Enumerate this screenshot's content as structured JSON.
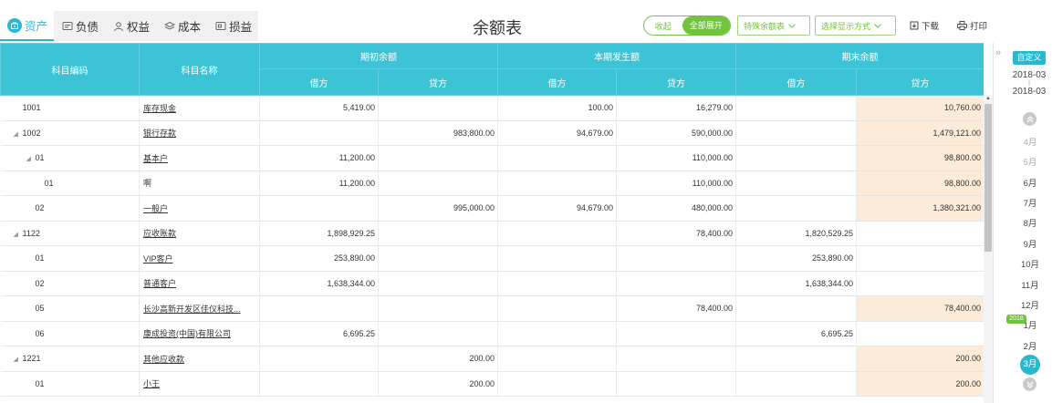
{
  "tabs": [
    {
      "label": "资产",
      "icon": "asset-icon",
      "active": true
    },
    {
      "label": "负债",
      "icon": "liability-icon",
      "active": false
    },
    {
      "label": "权益",
      "icon": "equity-icon",
      "active": false
    },
    {
      "label": "成本",
      "icon": "cost-icon",
      "active": false
    },
    {
      "label": "损益",
      "icon": "profit-loss-icon",
      "active": false
    }
  ],
  "title": "余额表",
  "toolbar": {
    "collapse_label": "收起",
    "expand_all_label": "全部展开",
    "special_balance_label": "特殊余额表",
    "display_mode_label": "选择显示方式",
    "download_label": "下载",
    "print_label": "打印"
  },
  "table": {
    "headers": {
      "code": "科目编码",
      "name": "科目名称",
      "opening": "期初余额",
      "current": "本期发生额",
      "closing": "期末余额",
      "debit": "借方",
      "credit": "贷方"
    },
    "rows": [
      {
        "code": "1001",
        "name": "库存现金",
        "op_debit": "5,419.00",
        "op_credit": "",
        "cur_debit": "100.00",
        "cur_credit": "16,279.00",
        "cl_debit": "",
        "cl_credit": "10,760.00"
      },
      {
        "code": "1002",
        "name": "银行存款",
        "op_debit": "",
        "op_credit": "983,800.00",
        "cur_debit": "94,679.00",
        "cur_credit": "590,000.00",
        "cl_debit": "",
        "cl_credit": "1,479,121.00"
      },
      {
        "code": "01",
        "name": "基本户",
        "op_debit": "11,200.00",
        "op_credit": "",
        "cur_debit": "",
        "cur_credit": "110,000.00",
        "cl_debit": "",
        "cl_credit": "98,800.00"
      },
      {
        "code": "01",
        "name": "啊",
        "op_debit": "11,200.00",
        "op_credit": "",
        "cur_debit": "",
        "cur_credit": "110,000.00",
        "cl_debit": "",
        "cl_credit": "98,800.00"
      },
      {
        "code": "02",
        "name": "一般户",
        "op_debit": "",
        "op_credit": "995,000.00",
        "cur_debit": "94,679.00",
        "cur_credit": "480,000.00",
        "cl_debit": "",
        "cl_credit": "1,380,321.00"
      },
      {
        "code": "1122",
        "name": "应收账款",
        "op_debit": "1,898,929.25",
        "op_credit": "",
        "cur_debit": "",
        "cur_credit": "78,400.00",
        "cl_debit": "1,820,529.25",
        "cl_credit": ""
      },
      {
        "code": "01",
        "name": "VIP客户",
        "op_debit": "253,890.00",
        "op_credit": "",
        "cur_debit": "",
        "cur_credit": "",
        "cl_debit": "253,890.00",
        "cl_credit": ""
      },
      {
        "code": "02",
        "name": "普通客户",
        "op_debit": "1,638,344.00",
        "op_credit": "",
        "cur_debit": "",
        "cur_credit": "",
        "cl_debit": "1,638,344.00",
        "cl_credit": ""
      },
      {
        "code": "05",
        "name": "长沙高新开发区佳仪科技...",
        "op_debit": "",
        "op_credit": "",
        "cur_debit": "",
        "cur_credit": "78,400.00",
        "cl_debit": "",
        "cl_credit": "78,400.00"
      },
      {
        "code": "06",
        "name": "康成投资(中国)有限公司",
        "op_debit": "6,695.25",
        "op_credit": "",
        "cur_debit": "",
        "cur_credit": "",
        "cl_debit": "6,695.25",
        "cl_credit": ""
      },
      {
        "code": "1221",
        "name": "其他应收款",
        "op_debit": "",
        "op_credit": "200.00",
        "cur_debit": "",
        "cur_credit": "",
        "cl_debit": "",
        "cl_credit": "200.00"
      },
      {
        "code": "01",
        "name": "小王",
        "op_debit": "",
        "op_credit": "200.00",
        "cur_debit": "",
        "cur_credit": "",
        "cl_debit": "",
        "cl_credit": "200.00"
      }
    ]
  },
  "period": {
    "custom_label": "自定义",
    "range_start": "2018-03",
    "range_sep": "|",
    "range_end": "2018-03",
    "year_tag": "2018",
    "months": [
      {
        "label": "4月",
        "dim": true
      },
      {
        "label": "5月",
        "dim": true
      },
      {
        "label": "6月",
        "dim": false
      },
      {
        "label": "7月",
        "dim": false
      },
      {
        "label": "8月",
        "dim": false
      },
      {
        "label": "9月",
        "dim": false
      },
      {
        "label": "10月",
        "dim": false
      },
      {
        "label": "11月",
        "dim": false
      },
      {
        "label": "12月",
        "dim": false
      },
      {
        "label": "1月",
        "dim": false
      },
      {
        "label": "2月",
        "dim": false
      },
      {
        "label": "3月",
        "dim": false,
        "current": true
      }
    ]
  },
  "colors": {
    "accent": "#29b8cf",
    "header_bg": "#3dc3d6",
    "green": "#70c43e",
    "closing_highlight": "#fcebd9"
  }
}
